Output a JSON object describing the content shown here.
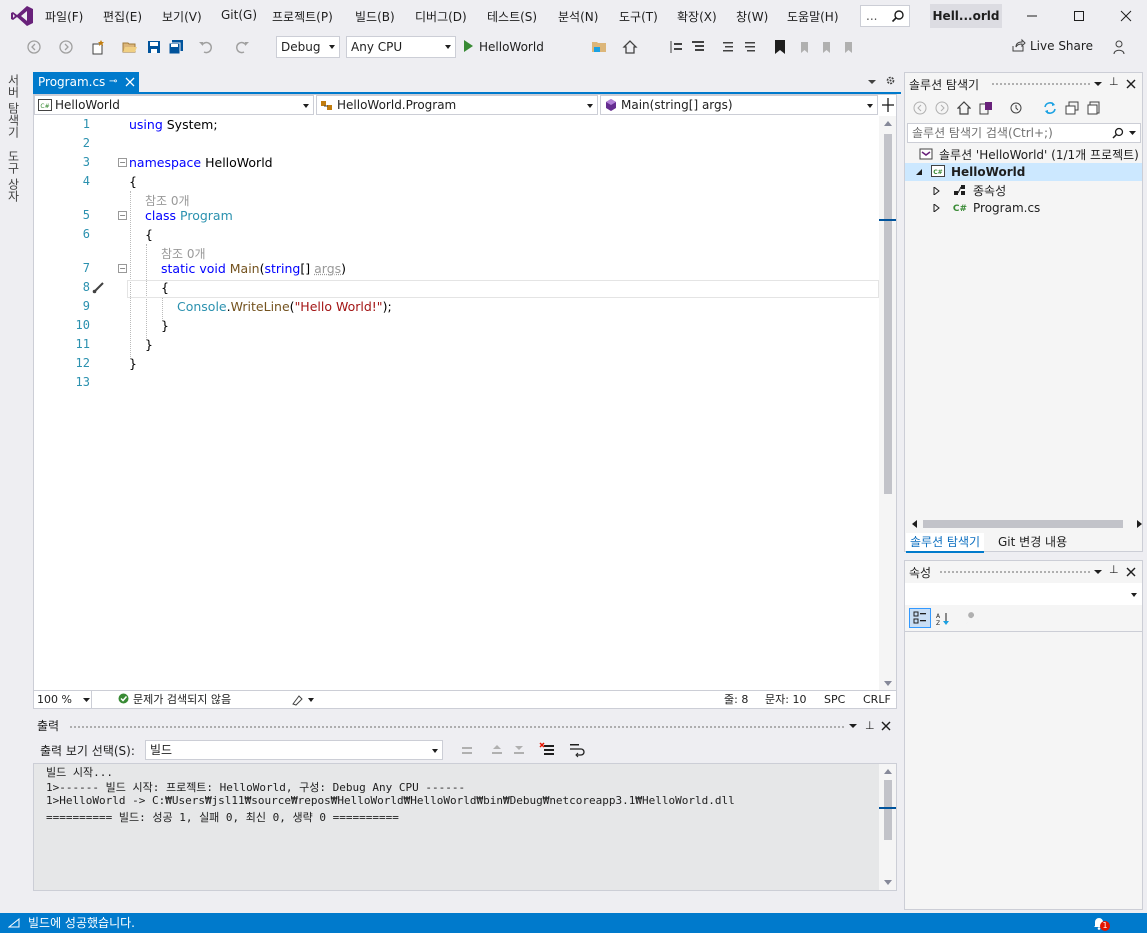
{
  "menu": {
    "items": [
      "파일(F)",
      "편집(E)",
      "보기(V)",
      "Git(G)",
      "프로젝트(P)",
      "빌드(B)",
      "디버그(D)",
      "테스트(S)",
      "분석(N)",
      "도구(T)",
      "확장(X)",
      "창(W)",
      "도움말(H)"
    ],
    "search_placeholder": "...",
    "window_title": "Hell...orld"
  },
  "toolbar": {
    "config": "Debug",
    "platform": "Any CPU",
    "run_target": "HelloWorld",
    "live_share": "Live Share"
  },
  "side_tabs": [
    "서버 탐색기",
    "도구 상자"
  ],
  "editor": {
    "tab_label": "Program.cs",
    "nav_project": "HelloWorld",
    "nav_class": "HelloWorld.Program",
    "nav_member": "Main(string[] args)",
    "line_numbers": [
      "1",
      "2",
      "3",
      "4",
      "5",
      "6",
      "7",
      "8",
      "9",
      "10",
      "11",
      "12",
      "13"
    ],
    "code": {
      "using_kw": "using",
      "system_ns": " System;",
      "namespace_kw": "namespace",
      "namespace_name": " HelloWorld",
      "open_brace": "{",
      "close_brace": "}",
      "refs": "참조 0개",
      "class_kw": "class",
      "class_name": "Program",
      "static_kw": "static",
      "void_kw": "void",
      "main_name": "Main",
      "paren_open": "(",
      "string_kw": "string",
      "array_brackets": "[]",
      "args": "args",
      "paren_close": ")",
      "console": "Console",
      "dot": ".",
      "writeline": "WriteLine",
      "hello": "\"Hello World!\"",
      "stmt_end": ");"
    },
    "zoom": "100 %",
    "issues": "문제가 검색되지 않음",
    "line_label": "줄: 8",
    "char_label": "문자: 10",
    "spc": "SPC",
    "crlf": "CRLF"
  },
  "output": {
    "title": "출력",
    "source_label": "출력 보기 선택(S):",
    "source_value": "빌드",
    "lines": [
      "빌드 시작...",
      "1>------ 빌드 시작: 프로젝트: HelloWorld, 구성: Debug Any CPU ------",
      "1>HelloWorld -> C:₩Users₩jsl11₩source₩repos₩HelloWorld₩HelloWorld₩bin₩Debug₩netcoreapp3.1₩HelloWorld.dll",
      "========== 빌드: 성공 1, 실패 0, 최신 0, 생략 0 =========="
    ]
  },
  "solution_explorer": {
    "title": "솔루션 탐색기",
    "search_placeholder": "솔루션 탐색기 검색(Ctrl+;)",
    "solution_label": "솔루션 'HelloWorld' (1/1개 프로젝트)",
    "project_label": "HelloWorld",
    "deps_label": "종속성",
    "file_label": "Program.cs",
    "tab_solution": "솔루션 탐색기",
    "tab_git": "Git 변경 내용"
  },
  "properties": {
    "title": "속성"
  },
  "status": {
    "message": "빌드에 성공했습니다.",
    "notification_count": "1"
  },
  "colors": {
    "accent": "#007acc",
    "keyword": "#0000ff",
    "type": "#2b91af",
    "string": "#a31515",
    "run_green": "#388a34"
  }
}
